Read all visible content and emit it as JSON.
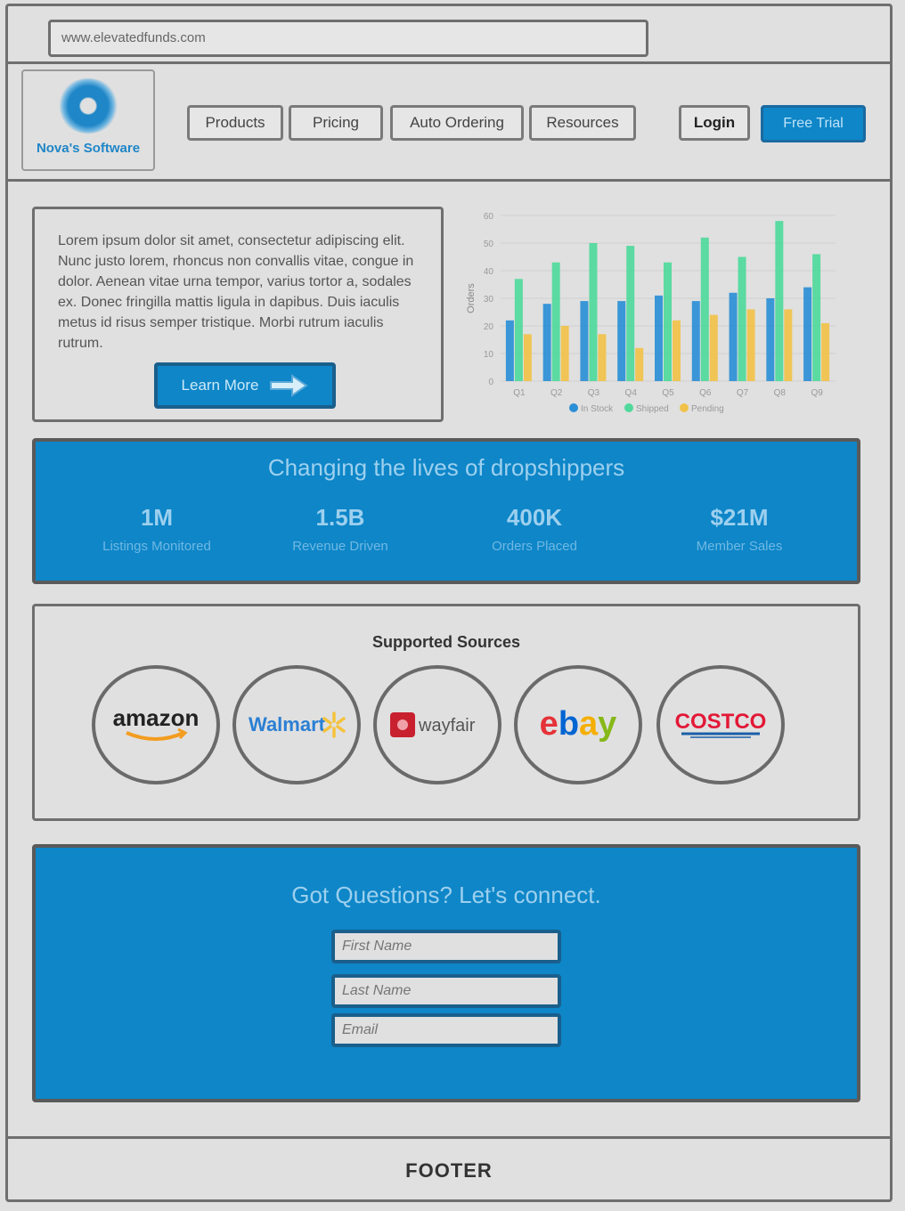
{
  "browser": {
    "url": "www.elevatedfunds.com"
  },
  "brand": {
    "name": "Nova's Software"
  },
  "nav": {
    "items": [
      "Products",
      "Pricing",
      "Auto Ordering",
      "Resources"
    ],
    "login": "Login",
    "cta": "Free Trial"
  },
  "intro": {
    "text": "Lorem ipsum dolor sit amet, consectetur adipiscing elit. Nunc justo lorem, rhoncus non convallis vitae, congue in dolor. Aenean vitae urna tempor, varius tortor a, sodales ex. Donec fringilla mattis ligula in dapibus. Duis iaculis metus id risus semper tristique. Morbi rutrum iaculis rutrum.",
    "button": "Learn More"
  },
  "colors": {
    "brand_blue": "#0e86c8",
    "series_blue": "#2b8fd6",
    "series_green": "#4fd99b",
    "series_yellow": "#f1c24a"
  },
  "chart_data": {
    "type": "bar",
    "title": "",
    "xlabel": "",
    "ylabel": "Orders",
    "categories": [
      "Q1",
      "Q2",
      "Q3",
      "Q4",
      "Q5",
      "Q6",
      "Q7",
      "Q8",
      "Q9"
    ],
    "ylim": [
      0,
      60
    ],
    "yticks": [
      0,
      10,
      20,
      30,
      40,
      50,
      60
    ],
    "grid": true,
    "legend_position": "bottom",
    "series": [
      {
        "name": "In Stock",
        "color": "#2b8fd6",
        "values": [
          22,
          28,
          29,
          29,
          31,
          29,
          32,
          30,
          34
        ]
      },
      {
        "name": "Shipped",
        "color": "#4fd99b",
        "values": [
          37,
          43,
          50,
          49,
          43,
          52,
          45,
          58,
          46
        ]
      },
      {
        "name": "Pending",
        "color": "#f1c24a",
        "values": [
          17,
          20,
          17,
          12,
          22,
          24,
          26,
          26,
          21
        ]
      }
    ]
  },
  "banner": {
    "title": "Changing the lives of dropshippers",
    "stats": [
      {
        "value": "1M",
        "label": "Listings Monitored"
      },
      {
        "value": "1.5B",
        "label": "Revenue Driven"
      },
      {
        "value": "400K",
        "label": "Orders Placed"
      },
      {
        "value": "$21M",
        "label": "Member Sales"
      }
    ]
  },
  "sources": {
    "title": "Supported Sources",
    "items": [
      {
        "name": "amazon",
        "label": "amazon"
      },
      {
        "name": "walmart",
        "label": "Walmart"
      },
      {
        "name": "wayfair",
        "label": "wayfair"
      },
      {
        "name": "ebay",
        "label": "ebay"
      },
      {
        "name": "costco",
        "label": "COSTCO"
      }
    ]
  },
  "contact": {
    "title": "Got Questions? Let's connect.",
    "first_name_placeholder": "First Name",
    "last_name_placeholder": "Last Name",
    "email_placeholder": "Email"
  },
  "footer": {
    "text": "FOOTER"
  }
}
